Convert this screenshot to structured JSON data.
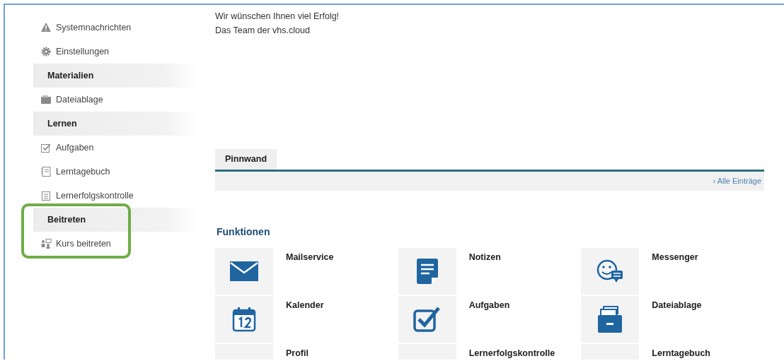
{
  "sidebar": {
    "items": [
      {
        "kind": "item",
        "label": "Systemnachrichten"
      },
      {
        "kind": "item",
        "label": "Einstellungen"
      },
      {
        "kind": "header",
        "label": "Materialien"
      },
      {
        "kind": "item",
        "label": "Dateiablage"
      },
      {
        "kind": "header",
        "label": "Lernen"
      },
      {
        "kind": "item",
        "label": "Aufgaben"
      },
      {
        "kind": "item",
        "label": "Lerntagebuch"
      },
      {
        "kind": "item",
        "label": "Lernerfolgskontrolle"
      },
      {
        "kind": "header",
        "label": "Beitreten",
        "highlighted": true
      },
      {
        "kind": "item",
        "label": "Kurs beitreten",
        "highlighted": true
      }
    ]
  },
  "message": [
    "Wir wünschen Ihnen viel Erfolg!",
    "Das Team der vhs.cloud"
  ],
  "pinboard": {
    "tab": {
      "label": "Pinnwand",
      "selected": true
    },
    "link": "› Alle Einträge"
  },
  "functions": {
    "title": "Funktionen",
    "tiles": [
      {
        "label": "Mailservice"
      },
      {
        "label": "Notizen"
      },
      {
        "label": "Messenger"
      },
      {
        "label": "Kalender"
      },
      {
        "label": "Aufgaben"
      },
      {
        "label": "Dateiablage"
      },
      {
        "label": "Profil"
      },
      {
        "label": "Lernerfolgskontrolle"
      },
      {
        "label": "Lerntagebuch"
      }
    ]
  }
}
